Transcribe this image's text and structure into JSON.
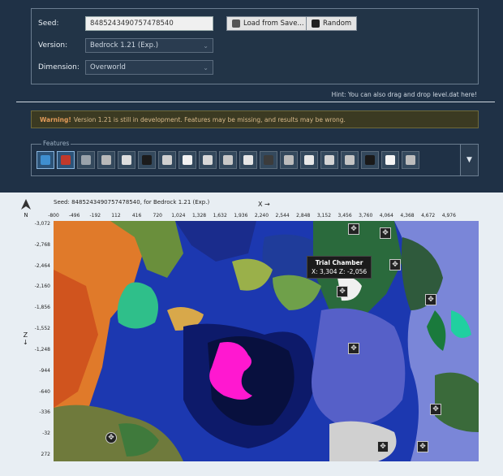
{
  "seed": {
    "label": "Seed:",
    "value": "8485243490757478540"
  },
  "version": {
    "label": "Version:",
    "selected": "Bedrock 1.21 (Exp.)"
  },
  "dimension": {
    "label": "Dimension:",
    "selected": "Overworld"
  },
  "buttons": {
    "load": "Load from Save...",
    "random": "Random"
  },
  "hint": "Hint: You can also drag and drop level.dat here!",
  "warning": {
    "strong": "Warning!",
    "text": "Version 1.21 is still in development. Features may be missing, and results may be wrong."
  },
  "features": {
    "legend": "Features",
    "icons": [
      {
        "name": "biome-icon",
        "color": "#3f8fd0",
        "active": true
      },
      {
        "name": "slime-chunk-icon",
        "color": "#c0392b",
        "active": true
      },
      {
        "name": "stronghold-icon",
        "color": "#9aa3ab"
      },
      {
        "name": "village-icon",
        "color": "#b9b9b9"
      },
      {
        "name": "ruined-portal-icon",
        "color": "#dedede"
      },
      {
        "name": "mineshaft-icon",
        "color": "#1c1c1c"
      },
      {
        "name": "ocean-monument-icon",
        "color": "#d0d0d0"
      },
      {
        "name": "igloo-icon",
        "color": "#f2f2f2"
      },
      {
        "name": "desert-temple-icon",
        "color": "#d8d8d8"
      },
      {
        "name": "jungle-temple-icon",
        "color": "#c8c8c8"
      },
      {
        "name": "fortress-icon",
        "color": "#e6e6e6"
      },
      {
        "name": "ancient-city-icon",
        "color": "#3c3c3c"
      },
      {
        "name": "trail-ruins-icon",
        "color": "#bcbcbc"
      },
      {
        "name": "shipwreck-icon",
        "color": "#e8e8e8"
      },
      {
        "name": "mansion-icon",
        "color": "#d4d4d4"
      },
      {
        "name": "treasure-icon",
        "color": "#c4c4c4"
      },
      {
        "name": "anchor-icon",
        "color": "#1a1a1a"
      },
      {
        "name": "spawn-icon",
        "color": "#f5f5f5"
      },
      {
        "name": "trial-chamber-icon",
        "color": "#bdbdbd"
      }
    ],
    "more": "▼"
  },
  "map": {
    "seed_line": "Seed: 8485243490757478540, for Bedrock 1.21 (Exp.)",
    "north": "N",
    "x_label": "X →",
    "z_label": "Z",
    "x_ticks": [
      "-800",
      "-496",
      "-192",
      "112",
      "416",
      "720",
      "1,024",
      "1,328",
      "1,632",
      "1,936",
      "2,240",
      "2,544",
      "2,848",
      "3,152",
      "3,456",
      "3,760",
      "4,064",
      "4,368",
      "4,672",
      "4,976"
    ],
    "z_ticks": [
      "-3,072",
      "-2,768",
      "-2,464",
      "-2,160",
      "-1,856",
      "-1,552",
      "-1,248",
      "-944",
      "-640",
      "-336",
      "-32",
      "272"
    ],
    "tooltip": {
      "title": "Trial Chamber",
      "coords": "X: 3,304 Z: -2,056"
    }
  }
}
